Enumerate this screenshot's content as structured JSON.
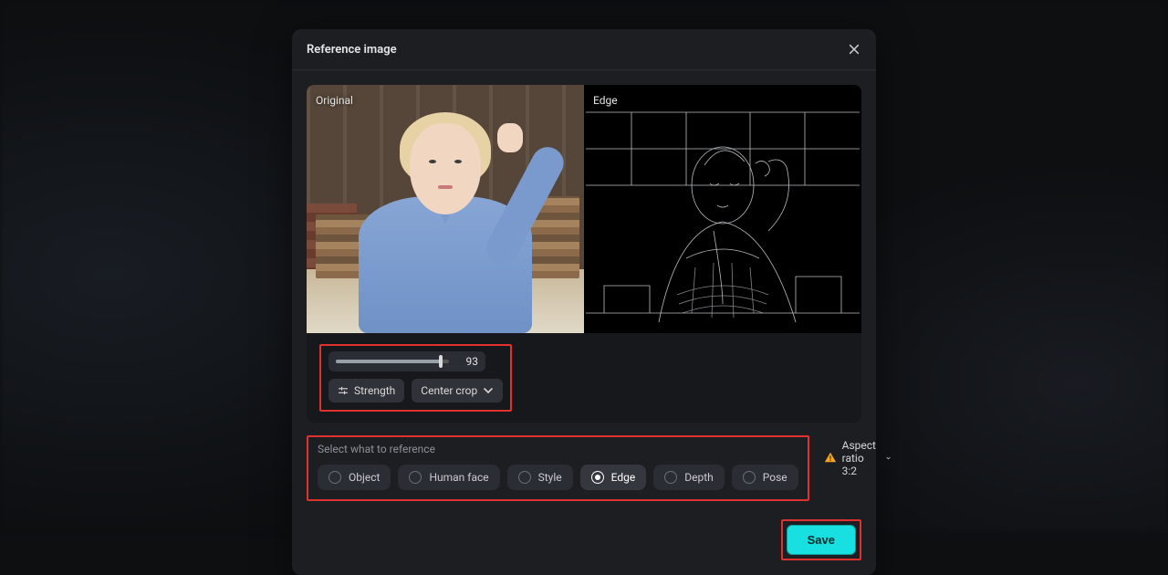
{
  "modal": {
    "title": "Reference image",
    "panes": {
      "original_label": "Original",
      "edge_label": "Edge"
    },
    "slider": {
      "value": "93"
    },
    "buttons": {
      "strength": "Strength",
      "crop": "Center crop"
    },
    "reference": {
      "title": "Select what to reference",
      "options": [
        {
          "label": "Object",
          "selected": false
        },
        {
          "label": "Human face",
          "selected": false
        },
        {
          "label": "Style",
          "selected": false
        },
        {
          "label": "Edge",
          "selected": true
        },
        {
          "label": "Depth",
          "selected": false
        },
        {
          "label": "Pose",
          "selected": false
        }
      ]
    },
    "aspect_label": "Aspect ratio 3:2",
    "save_label": "Save"
  }
}
